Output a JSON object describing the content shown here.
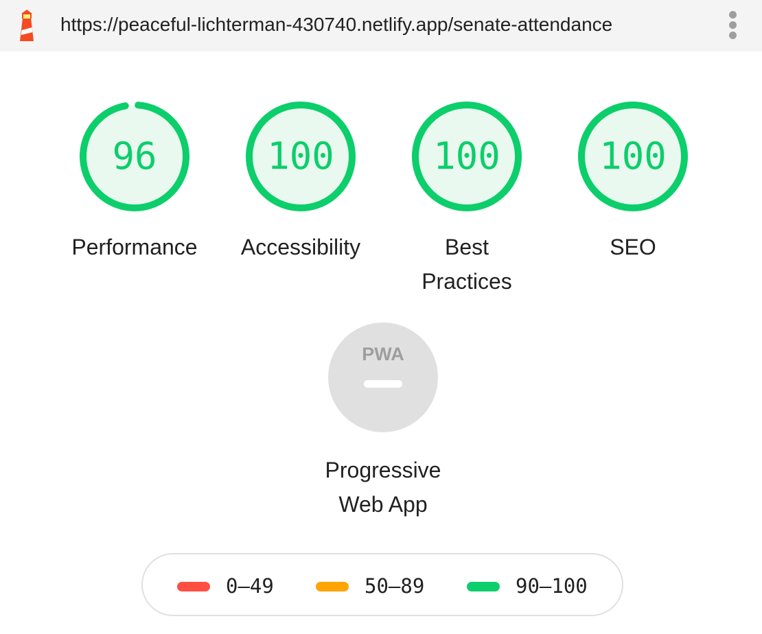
{
  "header": {
    "url": "https://peaceful-lichterman-430740.netlify.app/senate-attendance",
    "logo_icon": "lighthouse-icon",
    "menu_icon": "kebab-menu-icon"
  },
  "colors": {
    "pass": "#0cce6b",
    "average": "#ffa400",
    "fail": "#ff4e42",
    "pass_fill": "#e9f9ef",
    "pwa_gray": "#e0e0e0"
  },
  "categories": [
    {
      "id": "performance",
      "score": 96,
      "score_text": "96",
      "label_lines": [
        "Performance"
      ]
    },
    {
      "id": "accessibility",
      "score": 100,
      "score_text": "100",
      "label_lines": [
        "Accessibility"
      ]
    },
    {
      "id": "best-practices",
      "score": 100,
      "score_text": "100",
      "label_lines": [
        "Best",
        "Practices"
      ]
    },
    {
      "id": "seo",
      "score": 100,
      "score_text": "100",
      "label_lines": [
        "SEO"
      ]
    }
  ],
  "pwa": {
    "badge_text": "PWA",
    "label_lines": [
      "Progressive",
      "Web App"
    ]
  },
  "legend": [
    {
      "range": "0–49",
      "color_key": "fail"
    },
    {
      "range": "50–89",
      "color_key": "average"
    },
    {
      "range": "90–100",
      "color_key": "pass"
    }
  ]
}
